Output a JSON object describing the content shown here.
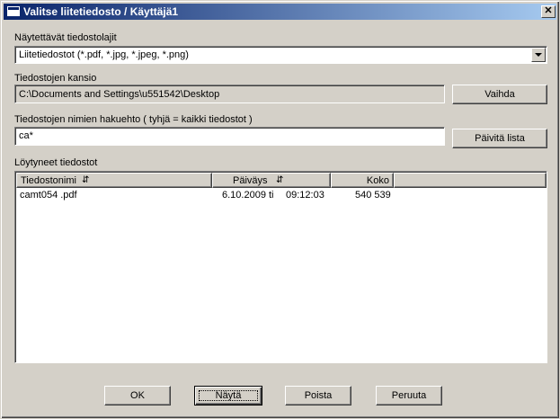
{
  "window": {
    "title": "Valitse liitetiedosto / Käyttäjä1",
    "close_label": "✕"
  },
  "filetypes": {
    "label": "Näytettävät tiedostolajit",
    "selected": "Liitetiedostot (*.pdf, *.jpg, *.jpeg, *.png)"
  },
  "folder": {
    "label": "Tiedostojen kansio",
    "path": "C:\\Documents and Settings\\u551542\\Desktop",
    "change_button": "Vaihda"
  },
  "search": {
    "label": "Tiedostojen nimien hakuehto ( tyhjä = kaikki tiedostot )",
    "value": "ca*",
    "refresh_button": "Päivitä lista"
  },
  "results": {
    "label": "Löytyneet tiedostot",
    "columns": {
      "name": "Tiedostonimi",
      "date": "Päiväys",
      "size": "Koko"
    },
    "rows": [
      {
        "name": "camt054 .pdf",
        "date": "6.10.2009 ti",
        "time": "09:12:03",
        "size": "540 539"
      }
    ]
  },
  "buttons": {
    "ok": "OK",
    "show": "Näytä",
    "delete": "Poista",
    "cancel": "Peruuta"
  },
  "icons": {
    "sort_name": "sort-icon",
    "sort_date": "sort-icon"
  }
}
